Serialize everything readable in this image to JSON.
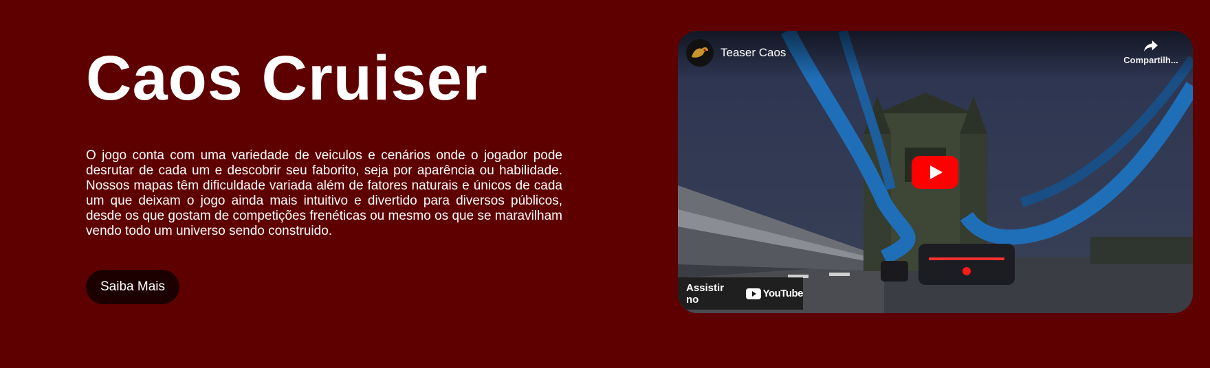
{
  "hero": {
    "title": "Caos Cruiser",
    "description": "O jogo conta com uma variedade de veiculos e cenários onde o jogador pode desrutar de cada um e descobrir seu faborito, seja por aparência ou habilidade. Nossos mapas têm dificuldade variada além de fatores naturais e únicos de cada um que deixam o jogo ainda mais intuitivo e divertido para diversos públicos, desde os que gostam de competições frenéticas ou mesmo os que se maravilham vendo todo um universo sendo construido.",
    "cta_label": "Saiba Mais"
  },
  "video": {
    "title": "Teaser Caos",
    "share_label": "Compartilh...",
    "watch_on_label": "Assistir no",
    "youtube_wordmark": "YouTube"
  },
  "icons": {
    "channel_avatar": "channel-avatar",
    "share": "share-icon",
    "play": "play-icon",
    "youtube_logo": "youtube-logo-icon"
  },
  "colors": {
    "page_background": "#5f0000",
    "button_background": "#1c0000",
    "youtube_red": "#ff0000",
    "text": "#ffffff"
  }
}
